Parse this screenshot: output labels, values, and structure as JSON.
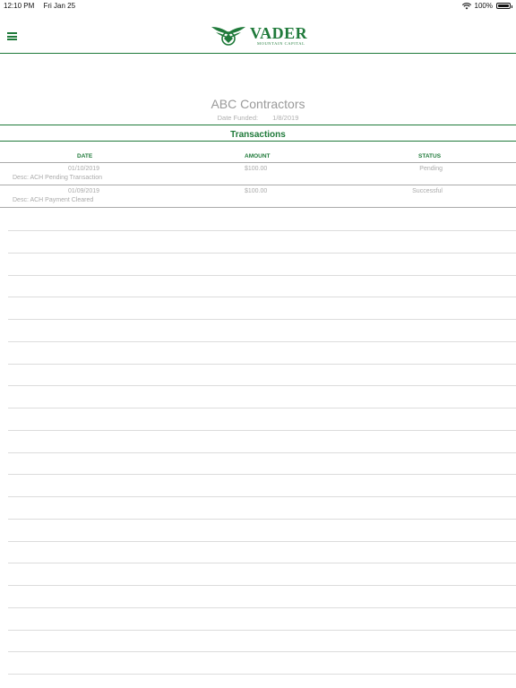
{
  "status_bar": {
    "time": "12:10 PM",
    "date": "Fri Jan 25",
    "battery": "100%"
  },
  "nav": {
    "menu_icon": "hamburger-menu-icon",
    "logo_icon": "eagle-emblem-icon",
    "logo_name": "VADER",
    "logo_tagline": "MOUNTAIN CAPITAL"
  },
  "deal": {
    "company": "ABC Contractors",
    "funded_label": "Date Funded:",
    "funded_date": "1/8/2019"
  },
  "section": {
    "title": "Transactions"
  },
  "table": {
    "columns": [
      "DATE",
      "AMOUNT",
      "STATUS"
    ],
    "rows": [
      {
        "date": "01/10/2019",
        "amount": "$100.00",
        "status": "Pending",
        "desc": "Desc:  ACH Pending Transaction"
      },
      {
        "date": "01/09/2019",
        "amount": "$100.00",
        "status": "Successful",
        "desc": "Desc:  ACH Payment Cleared"
      }
    ]
  },
  "colors": {
    "accent": "#1f7a3a",
    "muted_text": "#aaaaaa"
  }
}
